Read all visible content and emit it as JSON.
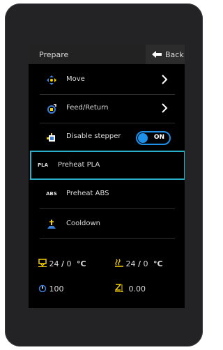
{
  "header": {
    "title": "Prepare",
    "back_label": "Back"
  },
  "menu": {
    "move": "Move",
    "feed": "Feed/Return",
    "disable_stepper": "Disable stepper",
    "toggle_state": "ON",
    "preheat_pla": "Preheat PLA",
    "pla_badge": "PLA",
    "preheat_abs": "Preheat ABS",
    "abs_badge": "ABS",
    "cooldown": "Cooldown"
  },
  "status": {
    "nozzle_current": "24",
    "nozzle_target": "0",
    "bed_current": "24",
    "bed_target": "0",
    "sep": "/",
    "unit": "°C",
    "speed": "100",
    "z": "0.00"
  },
  "colors": {
    "accent": "#2ab1c9",
    "toggle": "#1e90e8",
    "icon_yellow": "#f5d000",
    "icon_blue": "#3d7fd8"
  }
}
